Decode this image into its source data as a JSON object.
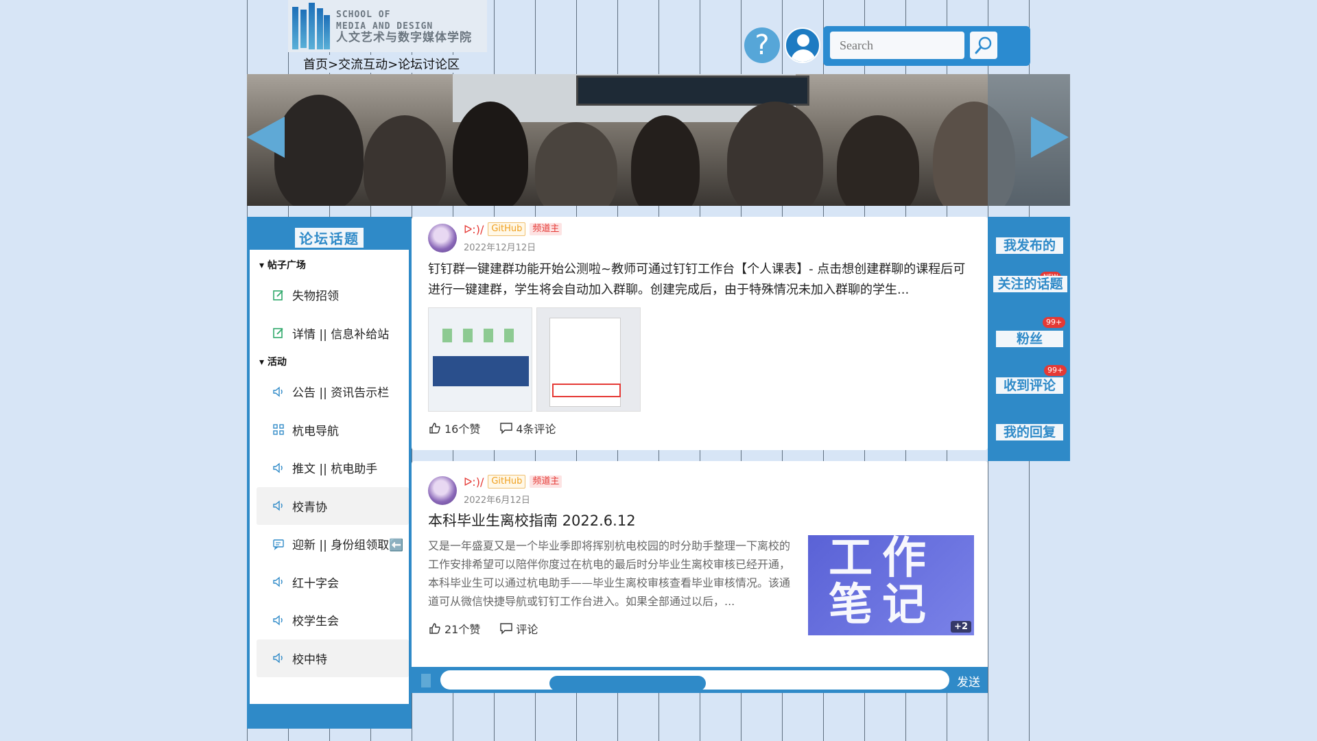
{
  "header": {
    "logo_en_1": "SCHOOL OF",
    "logo_en_2": "MEDIA AND DESIGN",
    "logo_cn": "人文艺术与数字媒体学院",
    "breadcrumb": "首页>交流互动>论坛讨论区",
    "help_glyph": "?",
    "search_placeholder": "Search"
  },
  "sidebar": {
    "title": "论坛话题",
    "groups": [
      {
        "label": "▾ 帖子广场",
        "items": [
          "失物招领",
          "详情 || 信息补给站"
        ]
      },
      {
        "label": "▾ 活动",
        "items": [
          "公告 || 资讯告示栏",
          "杭电导航",
          "推文 || 杭电助手",
          "校青协",
          "迎新 || 身份组领取⬅️",
          "红十字会",
          "校学生会",
          "校中特"
        ]
      }
    ]
  },
  "posts": [
    {
      "author": "ᐅ:)/",
      "tags": [
        "GitHub",
        "频道主"
      ],
      "date": "2022年12月12日",
      "text": "钉钉群一键建群功能开始公测啦~教师可通过钉钉工作台【个人课表】- 点击想创建群聊的课程后可进行一键建群，学生将会自动加入群聊。创建完成后，由于特殊情况未加入群聊的学生...",
      "likes": "16个赞",
      "comments": "4条评论"
    },
    {
      "author": "ᐅ:)/",
      "tags": [
        "GitHub",
        "频道主"
      ],
      "date": "2022年6月12日",
      "title": "本科毕业生离校指南 2022.6.12",
      "text": "又是一年盛夏又是一个毕业季即将挥别杭电校园的时分助手整理一下离校的工作安排希望可以陪伴你度过在杭电的最后时分毕业生离校审核已经开通，本科毕业生可以通过杭电助手——毕业生离校审核查看毕业审核情况。该通道可从微信快捷导航或钉钉工作台进入。如果全部通过以后，...",
      "image_text": "工作笔记",
      "image_more": "+2",
      "likes": "21个赞",
      "comments": "评论"
    }
  ],
  "composer": {
    "send_label": "发送",
    "scroll_fraction": 0.31
  },
  "rightbar": {
    "links": [
      "我发布的",
      "关注的话题",
      "粉丝",
      "收到评论",
      "我的回复"
    ],
    "badges": [
      "NEW",
      "99+",
      "99+"
    ]
  },
  "colors": {
    "accent": "#2f8ac8",
    "background": "#d7e5f6",
    "badge": "#e53935"
  }
}
